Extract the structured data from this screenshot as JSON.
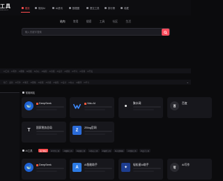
{
  "logo": {
    "main": "工具",
    "sub": "tools.ai.cn"
  },
  "nav": [
    {
      "label": "首页",
      "active": true
    },
    {
      "label": "常用AI",
      "active": false
    },
    {
      "label": "AI资讯",
      "active": false
    },
    {
      "label": "数据图",
      "active": false
    },
    {
      "label": "提交工具",
      "active": false
    },
    {
      "label": "排行榜",
      "active": false
    },
    {
      "label": "收藏",
      "active": false
    }
  ],
  "search": {
    "tabs": [
      "站内",
      "常用",
      "搜索",
      "工具",
      "社区",
      "生活"
    ],
    "active_tab": 0,
    "placeholder": "输入关键字搜索"
  },
  "bars": {
    "primary": [
      "AI工具",
      "AI写作",
      "AI图像",
      "AI视频",
      "AI办公",
      "AI编程",
      "AI音频",
      "AI设计",
      "AI搜索",
      "AI学习",
      "AI营销",
      "AI开发"
    ],
    "secondary": [
      "热门",
      "最新",
      "AI写作",
      "AI聊天",
      "AI图像",
      "AI视频",
      "AI音频",
      "AI编程",
      "AI设计",
      "AI办公",
      "AI翻译",
      "AI学习"
    ]
  },
  "sections": {
    "common": "常用网站",
    "ai": "AI工具"
  },
  "common_cards": [
    {
      "name": "DeepSeek",
      "badge": true,
      "avatar_bg": "#1e63d6",
      "avatar_glyph": "🐋",
      "icon": "deepseek-logo"
    },
    {
      "name": "Vidu AI",
      "badge": true,
      "avatar_bg": "#17171c",
      "avatar_glyph": "V",
      "icon": "vidu-logo"
    },
    {
      "name": "聚水网",
      "badge": false,
      "avatar_bg": "#17171c",
      "avatar_glyph": "●",
      "icon": "dot-logo"
    },
    {
      "name": "百度",
      "badge": false,
      "avatar_bg": "#2a2a30",
      "avatar_glyph": "百",
      "icon": "baidu-logo"
    },
    {
      "name": "国家税务总局",
      "badge": false,
      "avatar_bg": "#17171c",
      "avatar_glyph": "T",
      "icon": "tax-logo"
    },
    {
      "name": "ZBlog官网",
      "badge": false,
      "avatar_bg": "#2b6bd8",
      "avatar_glyph": "Z",
      "icon": "zblog-logo"
    }
  ],
  "ai_chips": [
    "热门网站",
    "AI写作工具",
    "AI图像工具",
    "AI视频工具",
    "AI办公工具",
    "AI编程工具",
    "AI对话聊天",
    "AI音频工具",
    "AI设计工具"
  ],
  "ai_cards": [
    {
      "name": "DeepSeek",
      "badge": true,
      "avatar_bg": "#1e63d6",
      "avatar_glyph": "🐋",
      "icon": "deepseek-logo"
    },
    {
      "name": "AI智能助手",
      "badge": false,
      "avatar_bg": "#2c7be5",
      "avatar_glyph": "A",
      "icon": "assistant-logo"
    },
    {
      "name": "轻松星AI助手",
      "badge": false,
      "avatar_bg": "#1d3d8f",
      "avatar_glyph": "✦",
      "icon": "star-logo"
    },
    {
      "name": "AI写作",
      "badge": false,
      "avatar_bg": "#2a2a30",
      "avatar_glyph": "写",
      "icon": "writing-logo"
    }
  ],
  "colors": {
    "accent": "#ff4d4f",
    "background": "#0b0b0d",
    "card": "#17171c"
  }
}
